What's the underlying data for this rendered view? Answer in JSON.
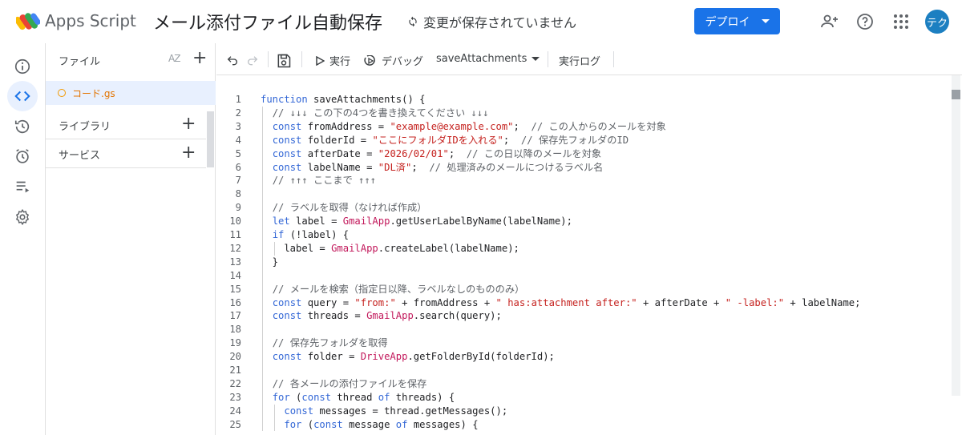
{
  "header": {
    "app_name": "Apps Script",
    "project_title": "メール添付ファイル自動保存",
    "save_status": "変更が保存されていません",
    "deploy_label": "デプロイ",
    "avatar_text": "テク"
  },
  "files_panel": {
    "title": "ファイル",
    "sort_icon": "AZ",
    "files": [
      {
        "name": "コード.gs"
      }
    ],
    "libraries_label": "ライブラリ",
    "services_label": "サービス"
  },
  "toolbar": {
    "run_label": "実行",
    "debug_label": "デバッグ",
    "function_select": "saveAttachments",
    "log_label": "実行ログ"
  },
  "code_lines": [
    "function saveAttachments() {",
    "  // ↓↓↓ この下の4つを書き換えてください ↓↓↓",
    "  const fromAddress = \"example@example.com\";  // この人からのメールを対象",
    "  const folderId = \"ここにフォルダIDを入れる\";  // 保存先フォルダのID",
    "  const afterDate = \"2026/02/01\";  // この日以降のメールを対象",
    "  const labelName = \"DL済\";  // 処理済みのメールにつけるラベル名",
    "  // ↑↑↑ ここまで ↑↑↑",
    "",
    "  // ラベルを取得（なければ作成）",
    "  let label = GmailApp.getUserLabelByName(labelName);",
    "  if (!label) {",
    "    label = GmailApp.createLabel(labelName);",
    "  }",
    "",
    "  // メールを検索（指定日以降、ラベルなしのもののみ）",
    "  const query = \"from:\" + fromAddress + \" has:attachment after:\" + afterDate + \" -label:\" + labelName;",
    "  const threads = GmailApp.search(query);",
    "",
    "  // 保存先フォルダを取得",
    "  const folder = DriveApp.getFolderById(folderId);",
    "",
    "  // 各メールの添付ファイルを保存",
    "  for (const thread of threads) {",
    "    const messages = thread.getMessages();",
    "    for (const message of messages) {"
  ],
  "colors": {
    "accent": "#1a73e8",
    "string": "#c5221f",
    "keyword": "#1a0dab",
    "class": "#c2185b",
    "comment": "#5f6368",
    "file_active": "#e37400"
  }
}
